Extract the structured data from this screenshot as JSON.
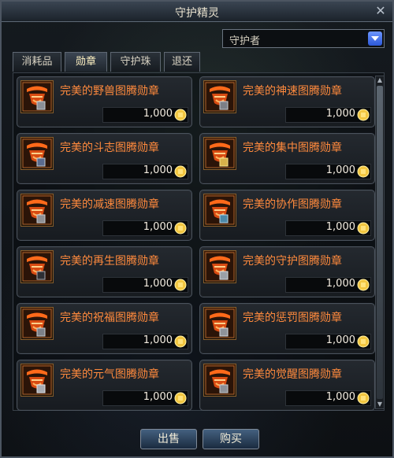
{
  "window": {
    "title": "守护精灵"
  },
  "dropdown": {
    "selected": "守护者"
  },
  "tabs": [
    "消耗品",
    "勋章",
    "守护珠",
    "退还"
  ],
  "items": [
    {
      "name": "完美的野兽图腾勋章",
      "price": "1,000"
    },
    {
      "name": "完美的神速图腾勋章",
      "price": "1,000"
    },
    {
      "name": "完美的斗志图腾勋章",
      "price": "1,000"
    },
    {
      "name": "完美的集中图腾勋章",
      "price": "1,000"
    },
    {
      "name": "完美的减速图腾勋章",
      "price": "1,000"
    },
    {
      "name": "完美的协作图腾勋章",
      "price": "1,000"
    },
    {
      "name": "完美的再生图腾勋章",
      "price": "1,000"
    },
    {
      "name": "完美的守护图腾勋章",
      "price": "1,000"
    },
    {
      "name": "完美的祝福图腾勋章",
      "price": "1,000"
    },
    {
      "name": "完美的惩罚图腾勋章",
      "price": "1,000"
    },
    {
      "name": "完美的元气图腾勋章",
      "price": "1,000"
    },
    {
      "name": "完美的觉醒图腾勋章",
      "price": "1,000"
    }
  ],
  "footer": {
    "sell": "出售",
    "buy": "购买"
  },
  "icons": {
    "close": "close-icon",
    "dropdown": "chevron-down-icon",
    "item": "totem-medal-icon",
    "currency": "gold-coin-icon",
    "scroll_up": "scroll-up-icon",
    "scroll_down": "scroll-down-icon"
  },
  "colors": {
    "item_name": "#ff8a3d",
    "accent_button": "#2c58d8",
    "price_text": "#f3ece0"
  }
}
